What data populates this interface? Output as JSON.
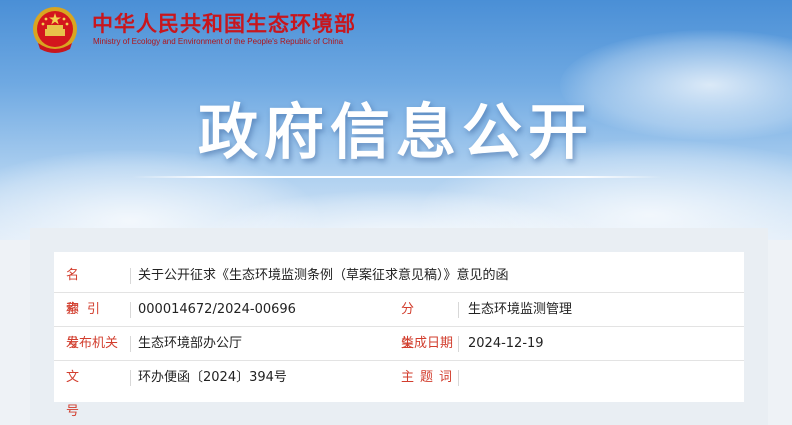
{
  "header": {
    "site_title": "中华人民共和国生态环境部",
    "site_subtitle": "Ministry of Ecology and Environment of the People's Republic of China",
    "emblem_icon": "national-emblem-icon"
  },
  "banner": {
    "heading": "政府信息公开"
  },
  "info": {
    "name_label": "名称",
    "name_value": "关于公开征求《生态环境监测条例（草案征求意见稿）》意见的函",
    "index_label": "索引号",
    "index_value": "000014672/2024-00696",
    "category_label": "分类",
    "category_value": "生态环境监测管理",
    "issuer_label": "发布机关",
    "issuer_value": "生态环境部办公厅",
    "date_label": "生成日期",
    "date_value": "2024-12-19",
    "docno_label": "文号",
    "docno_value": "环办便函〔2024〕394号",
    "keywords_label": "主题词",
    "keywords_value": ""
  },
  "colors": {
    "brand_red": "#c8161d",
    "label_red": "#d23e2e",
    "sky_blue": "#4a8fd6"
  }
}
